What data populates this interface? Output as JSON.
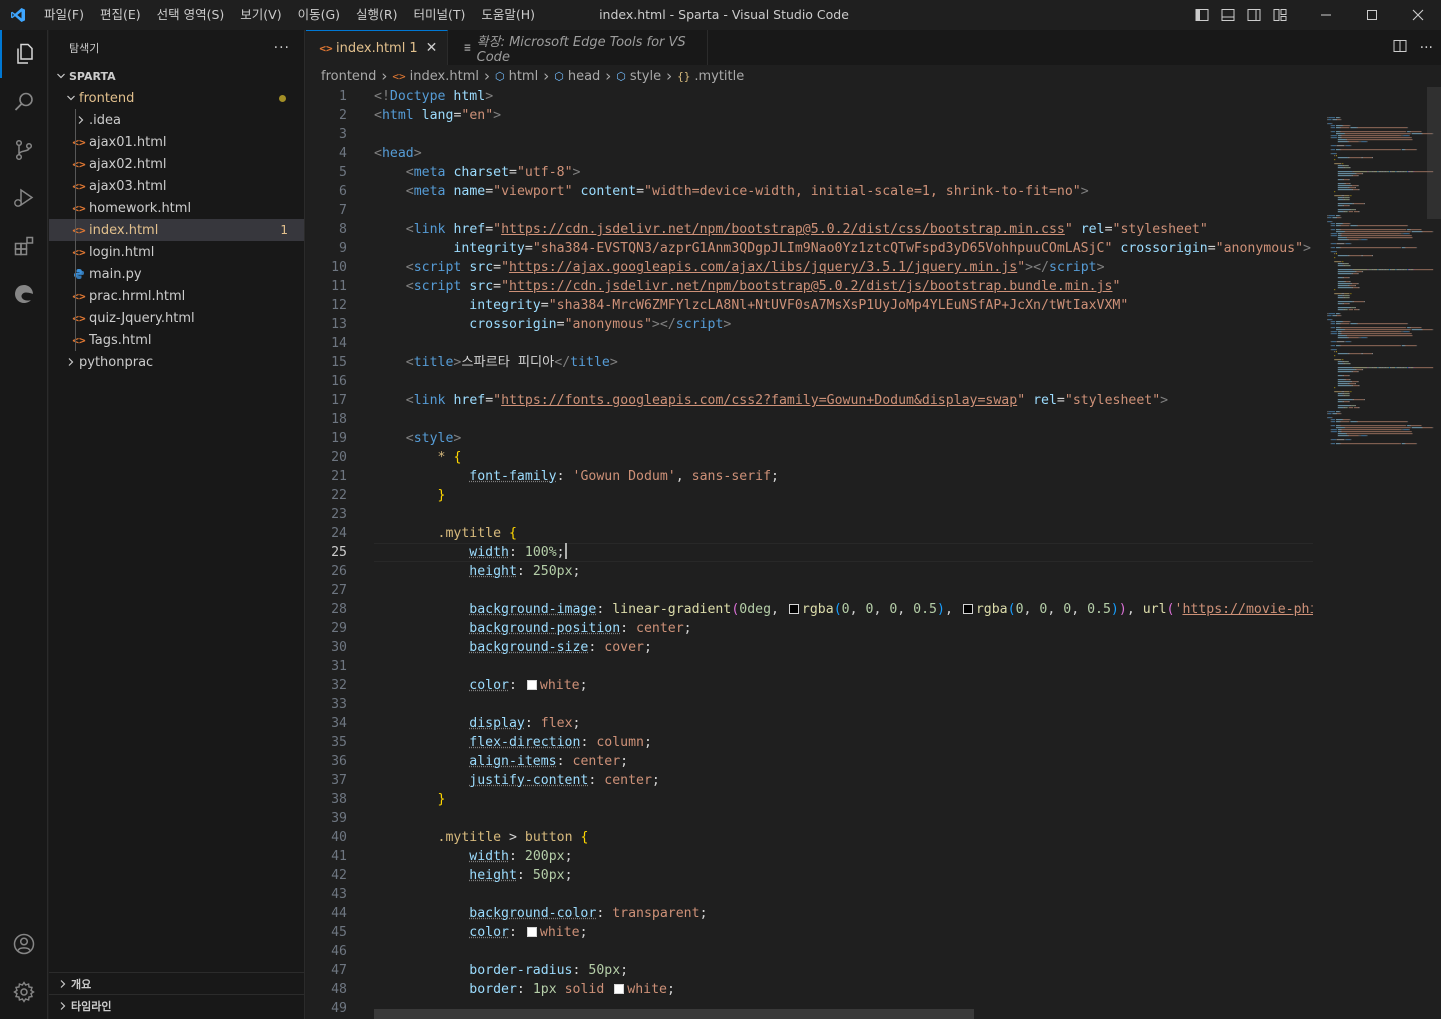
{
  "window": {
    "title": "index.html - Sparta - Visual Studio Code",
    "accent": "#0078d4"
  },
  "menu": [
    "파일(F)",
    "편집(E)",
    "선택 영역(S)",
    "보기(V)",
    "이동(G)",
    "실행(R)",
    "터미널(T)",
    "도움말(H)"
  ],
  "sidebar": {
    "title": "탐색기",
    "more": "···",
    "root": "SPARTA",
    "items": [
      {
        "label": "frontend",
        "kind": "folder-open",
        "level": 1
      },
      {
        "label": ".idea",
        "kind": "folder",
        "level": 2
      },
      {
        "label": "ajax01.html",
        "kind": "html",
        "level": 2
      },
      {
        "label": "ajax02.html",
        "kind": "html",
        "level": 2
      },
      {
        "label": "ajax03.html",
        "kind": "html",
        "level": 2
      },
      {
        "label": "homework.html",
        "kind": "html",
        "level": 2
      },
      {
        "label": "index.html",
        "kind": "html",
        "level": 2,
        "badge": "1"
      },
      {
        "label": "login.html",
        "kind": "html",
        "level": 2
      },
      {
        "label": "main.py",
        "kind": "python",
        "level": 2
      },
      {
        "label": "prac.hrml.html",
        "kind": "html",
        "level": 2
      },
      {
        "label": "quiz-Jquery.html",
        "kind": "html",
        "level": 2
      },
      {
        "label": "Tags.html",
        "kind": "html",
        "level": 2
      },
      {
        "label": "pythonprac",
        "kind": "folder",
        "level": 1
      }
    ],
    "outline": "개요",
    "timeline": "타임라인"
  },
  "tabs": [
    {
      "label": "index.html",
      "badge": "1",
      "active": true
    },
    {
      "label": "확장: Microsoft Edge Tools for VS Code",
      "active": false
    }
  ],
  "breadcrumb": [
    "frontend",
    "index.html",
    "html",
    "head",
    "style",
    ".mytitle"
  ],
  "editor": {
    "line_numbers": [
      "1",
      "2",
      "3",
      "4",
      "5",
      "6",
      "7",
      "8",
      "9",
      "10",
      "11",
      "12",
      "13",
      "14",
      "15",
      "16",
      "17",
      "18",
      "19",
      "20",
      "21",
      "22",
      "23",
      "24",
      "25",
      "26",
      "27",
      "28",
      "29",
      "30",
      "31",
      "32",
      "33",
      "34",
      "35",
      "36",
      "37",
      "38",
      "39",
      "40",
      "41",
      "42",
      "43",
      "44",
      "45",
      "46",
      "47",
      "48",
      "49"
    ],
    "current_line": "25",
    "lines": [
      [
        [
          "t",
          "<!"
        ],
        [
          "tn",
          "Doctype"
        ],
        [
          "pl",
          " "
        ],
        [
          "at",
          "html"
        ],
        [
          "t",
          ">"
        ]
      ],
      [
        [
          "t",
          "<"
        ],
        [
          "tn",
          "html"
        ],
        [
          "pl",
          " "
        ],
        [
          "at",
          "lang"
        ],
        [
          "pl",
          "="
        ],
        [
          "sv",
          "\"en\""
        ],
        [
          "t",
          ">"
        ]
      ],
      [],
      [
        [
          "t",
          "<"
        ],
        [
          "tn",
          "head"
        ],
        [
          "t",
          ">"
        ]
      ],
      [
        [
          "pl",
          "    "
        ],
        [
          "t",
          "<"
        ],
        [
          "tn",
          "meta"
        ],
        [
          "pl",
          " "
        ],
        [
          "at",
          "charset"
        ],
        [
          "pl",
          "="
        ],
        [
          "sv",
          "\"utf-8\""
        ],
        [
          "t",
          ">"
        ]
      ],
      [
        [
          "pl",
          "    "
        ],
        [
          "t",
          "<"
        ],
        [
          "tn",
          "meta"
        ],
        [
          "pl",
          " "
        ],
        [
          "at",
          "name"
        ],
        [
          "pl",
          "="
        ],
        [
          "sv",
          "\"viewport\""
        ],
        [
          "pl",
          " "
        ],
        [
          "at",
          "content"
        ],
        [
          "pl",
          "="
        ],
        [
          "sv",
          "\"width=device-width, initial-scale=1, shrink-to-fit=no\""
        ],
        [
          "t",
          ">"
        ]
      ],
      [],
      [
        [
          "pl",
          "    "
        ],
        [
          "t",
          "<"
        ],
        [
          "tn",
          "link"
        ],
        [
          "pl",
          " "
        ],
        [
          "at",
          "href"
        ],
        [
          "pl",
          "="
        ],
        [
          "sv",
          "\""
        ],
        [
          "svu",
          "https://cdn.jsdelivr.net/npm/bootstrap@5.0.2/dist/css/bootstrap.min.css"
        ],
        [
          "sv",
          "\""
        ],
        [
          "pl",
          " "
        ],
        [
          "at",
          "rel"
        ],
        [
          "pl",
          "="
        ],
        [
          "sv",
          "\"stylesheet\""
        ]
      ],
      [
        [
          "pl",
          "          "
        ],
        [
          "at",
          "integrity"
        ],
        [
          "pl",
          "="
        ],
        [
          "sv",
          "\"sha384-EVSTQN3/azprG1Anm3QDgpJLIm9Nao0Yz1ztcQTwFspd3yD65VohhpuuCOmLASjC\""
        ],
        [
          "pl",
          " "
        ],
        [
          "at",
          "crossorigin"
        ],
        [
          "pl",
          "="
        ],
        [
          "sv",
          "\"anonymous\""
        ],
        [
          "t",
          ">"
        ]
      ],
      [
        [
          "pl",
          "    "
        ],
        [
          "t",
          "<"
        ],
        [
          "tn",
          "script"
        ],
        [
          "pl",
          " "
        ],
        [
          "at",
          "src"
        ],
        [
          "pl",
          "="
        ],
        [
          "sv",
          "\""
        ],
        [
          "svu",
          "https://ajax.googleapis.com/ajax/libs/jquery/3.5.1/jquery.min.js"
        ],
        [
          "sv",
          "\""
        ],
        [
          "t",
          "></"
        ],
        [
          "tn",
          "script"
        ],
        [
          "t",
          ">"
        ]
      ],
      [
        [
          "pl",
          "    "
        ],
        [
          "t",
          "<"
        ],
        [
          "tn",
          "script"
        ],
        [
          "pl",
          " "
        ],
        [
          "at",
          "src"
        ],
        [
          "pl",
          "="
        ],
        [
          "sv",
          "\""
        ],
        [
          "svu",
          "https://cdn.jsdelivr.net/npm/bootstrap@5.0.2/dist/js/bootstrap.bundle.min.js"
        ],
        [
          "sv",
          "\""
        ]
      ],
      [
        [
          "pl",
          "            "
        ],
        [
          "at",
          "integrity"
        ],
        [
          "pl",
          "="
        ],
        [
          "sv",
          "\"sha384-MrcW6ZMFYlzcLA8Nl+NtUVF0sA7MsXsP1UyJoMp4YLEuNSfAP+JcXn/tWtIaxVXM\""
        ]
      ],
      [
        [
          "pl",
          "            "
        ],
        [
          "at",
          "crossorigin"
        ],
        [
          "pl",
          "="
        ],
        [
          "sv",
          "\"anonymous\""
        ],
        [
          "t",
          "></"
        ],
        [
          "tn",
          "script"
        ],
        [
          "t",
          ">"
        ]
      ],
      [],
      [
        [
          "pl",
          "    "
        ],
        [
          "t",
          "<"
        ],
        [
          "tn",
          "title"
        ],
        [
          "t",
          ">"
        ],
        [
          "pl",
          "스파르타 피디아"
        ],
        [
          "t",
          "</"
        ],
        [
          "tn",
          "title"
        ],
        [
          "t",
          ">"
        ]
      ],
      [],
      [
        [
          "pl",
          "    "
        ],
        [
          "t",
          "<"
        ],
        [
          "tn",
          "link"
        ],
        [
          "pl",
          " "
        ],
        [
          "at",
          "href"
        ],
        [
          "pl",
          "="
        ],
        [
          "sv",
          "\""
        ],
        [
          "svu",
          "https://fonts.googleapis.com/css2?family=Gowun+Dodum&display=swap"
        ],
        [
          "sv",
          "\""
        ],
        [
          "pl",
          " "
        ],
        [
          "at",
          "rel"
        ],
        [
          "pl",
          "="
        ],
        [
          "sv",
          "\"stylesheet\""
        ],
        [
          "t",
          ">"
        ]
      ],
      [],
      [
        [
          "pl",
          "    "
        ],
        [
          "t",
          "<"
        ],
        [
          "tn",
          "style"
        ],
        [
          "t",
          ">"
        ]
      ],
      [
        [
          "pl",
          "        "
        ],
        [
          "sel",
          "*"
        ],
        [
          "pl",
          " "
        ],
        [
          "br1",
          "{"
        ]
      ],
      [
        [
          "pl",
          "            "
        ],
        [
          "prd",
          "font-family"
        ],
        [
          "pl",
          ": "
        ],
        [
          "vl",
          "'Gowun Dodum'"
        ],
        [
          "pl",
          ", "
        ],
        [
          "vl",
          "sans-serif"
        ],
        [
          "pl",
          ";"
        ]
      ],
      [
        [
          "pl",
          "        "
        ],
        [
          "br1",
          "}"
        ]
      ],
      [],
      [
        [
          "pl",
          "        "
        ],
        [
          "sel",
          ".mytitle"
        ],
        [
          "pl",
          " "
        ],
        [
          "br1",
          "{"
        ]
      ],
      [
        [
          "pl",
          "            "
        ],
        [
          "prd",
          "width"
        ],
        [
          "pl",
          ": "
        ],
        [
          "nm",
          "100%"
        ],
        [
          "pl",
          ";"
        ],
        [
          "cursor",
          ""
        ]
      ],
      [
        [
          "pl",
          "            "
        ],
        [
          "prd",
          "height"
        ],
        [
          "pl",
          ": "
        ],
        [
          "nm",
          "250px"
        ],
        [
          "pl",
          ";"
        ]
      ],
      [],
      [
        [
          "pl",
          "            "
        ],
        [
          "prd",
          "background-image"
        ],
        [
          "pl",
          ": "
        ],
        [
          "fn",
          "linear-gradient"
        ],
        [
          "br2",
          "("
        ],
        [
          "nm",
          "0deg"
        ],
        [
          "pl",
          ", "
        ],
        [
          "swb",
          ""
        ],
        [
          "fn",
          "rgba"
        ],
        [
          "br3",
          "("
        ],
        [
          "nm",
          "0"
        ],
        [
          "pl",
          ", "
        ],
        [
          "nm",
          "0"
        ],
        [
          "pl",
          ", "
        ],
        [
          "nm",
          "0"
        ],
        [
          "pl",
          ", "
        ],
        [
          "nm",
          "0.5"
        ],
        [
          "br3",
          ")"
        ],
        [
          "pl",
          ", "
        ],
        [
          "swb",
          ""
        ],
        [
          "fn",
          "rgba"
        ],
        [
          "br3",
          "("
        ],
        [
          "nm",
          "0"
        ],
        [
          "pl",
          ", "
        ],
        [
          "nm",
          "0"
        ],
        [
          "pl",
          ", "
        ],
        [
          "nm",
          "0"
        ],
        [
          "pl",
          ", "
        ],
        [
          "nm",
          "0.5"
        ],
        [
          "br3",
          ")"
        ],
        [
          "br2",
          ")"
        ],
        [
          "pl",
          ", "
        ],
        [
          "fn",
          "url"
        ],
        [
          "br2",
          "("
        ],
        [
          "vl",
          "'"
        ],
        [
          "svu",
          "https://movie-phinf."
        ]
      ],
      [
        [
          "pl",
          "            "
        ],
        [
          "prd",
          "background-position"
        ],
        [
          "pl",
          ": "
        ],
        [
          "vl",
          "center"
        ],
        [
          "pl",
          ";"
        ]
      ],
      [
        [
          "pl",
          "            "
        ],
        [
          "prd",
          "background-size"
        ],
        [
          "pl",
          ": "
        ],
        [
          "vl",
          "cover"
        ],
        [
          "pl",
          ";"
        ]
      ],
      [],
      [
        [
          "pl",
          "            "
        ],
        [
          "prd",
          "color"
        ],
        [
          "pl",
          ": "
        ],
        [
          "sww",
          ""
        ],
        [
          "vl",
          "white"
        ],
        [
          "pl",
          ";"
        ]
      ],
      [],
      [
        [
          "pl",
          "            "
        ],
        [
          "prd",
          "display"
        ],
        [
          "pl",
          ": "
        ],
        [
          "vl",
          "flex"
        ],
        [
          "pl",
          ";"
        ]
      ],
      [
        [
          "pl",
          "            "
        ],
        [
          "prd",
          "flex-direction"
        ],
        [
          "pl",
          ": "
        ],
        [
          "vl",
          "column"
        ],
        [
          "pl",
          ";"
        ]
      ],
      [
        [
          "pl",
          "            "
        ],
        [
          "prd",
          "align-items"
        ],
        [
          "pl",
          ": "
        ],
        [
          "vl",
          "center"
        ],
        [
          "pl",
          ";"
        ]
      ],
      [
        [
          "pl",
          "            "
        ],
        [
          "prd",
          "justify-content"
        ],
        [
          "pl",
          ": "
        ],
        [
          "vl",
          "center"
        ],
        [
          "pl",
          ";"
        ]
      ],
      [
        [
          "pl",
          "        "
        ],
        [
          "br1",
          "}"
        ]
      ],
      [],
      [
        [
          "pl",
          "        "
        ],
        [
          "sel",
          ".mytitle"
        ],
        [
          "pl",
          " > "
        ],
        [
          "sel",
          "button"
        ],
        [
          "pl",
          " "
        ],
        [
          "br1",
          "{"
        ]
      ],
      [
        [
          "pl",
          "            "
        ],
        [
          "prd",
          "width"
        ],
        [
          "pl",
          ": "
        ],
        [
          "nm",
          "200px"
        ],
        [
          "pl",
          ";"
        ]
      ],
      [
        [
          "pl",
          "            "
        ],
        [
          "prd",
          "height"
        ],
        [
          "pl",
          ": "
        ],
        [
          "nm",
          "50px"
        ],
        [
          "pl",
          ";"
        ]
      ],
      [],
      [
        [
          "pl",
          "            "
        ],
        [
          "prd",
          "background-color"
        ],
        [
          "pl",
          ": "
        ],
        [
          "vl",
          "transparent"
        ],
        [
          "pl",
          ";"
        ]
      ],
      [
        [
          "pl",
          "            "
        ],
        [
          "prd",
          "color"
        ],
        [
          "pl",
          ": "
        ],
        [
          "sww",
          ""
        ],
        [
          "vl",
          "white"
        ],
        [
          "pl",
          ";"
        ]
      ],
      [],
      [
        [
          "pl",
          "            "
        ],
        [
          "pr",
          "border-radius"
        ],
        [
          "pl",
          ": "
        ],
        [
          "nm",
          "50px"
        ],
        [
          "pl",
          ";"
        ]
      ],
      [
        [
          "pl",
          "            "
        ],
        [
          "pr",
          "border"
        ],
        [
          "pl",
          ": "
        ],
        [
          "nm",
          "1px"
        ],
        [
          "pl",
          " "
        ],
        [
          "vl",
          "solid"
        ],
        [
          "pl",
          " "
        ],
        [
          "sww",
          ""
        ],
        [
          "vl",
          "white"
        ],
        [
          "pl",
          ";"
        ]
      ],
      []
    ]
  }
}
